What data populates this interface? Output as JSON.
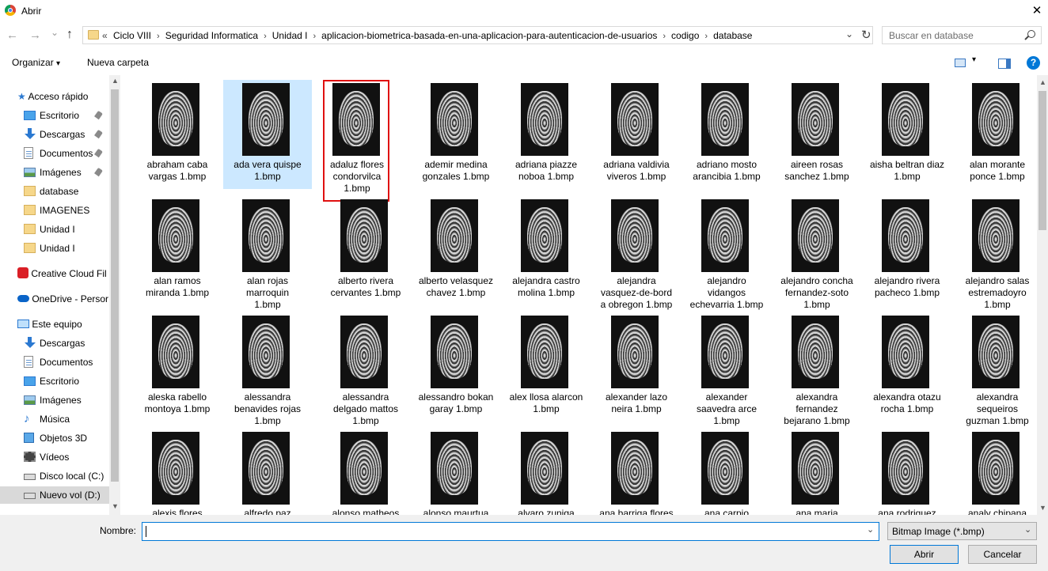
{
  "window": {
    "title": "Abrir",
    "close_glyph": "✕"
  },
  "nav_buttons": {
    "back": "←",
    "forward": "→",
    "recent": "⌄",
    "up": "↑"
  },
  "address": {
    "overflow": "«",
    "crumbs": [
      "Ciclo VIII",
      "Seguridad Informatica",
      "Unidad I",
      "aplicacion-biometrica-basada-en-una-aplicacion-para-autenticacion-de-usuarios",
      "codigo",
      "database"
    ],
    "separator": "›",
    "dropdown_glyph": "⌄",
    "refresh_glyph": "↻",
    "search_placeholder": "Buscar en database"
  },
  "toolbar": {
    "organize": "Organizar",
    "organize_arrow": "▾",
    "new_folder": "Nueva carpeta",
    "help": "?"
  },
  "sidebar": {
    "quick_access": "Acceso rápido",
    "quick_items": [
      {
        "label": "Escritorio",
        "icon": "desktop-icon",
        "pinned": true
      },
      {
        "label": "Descargas",
        "icon": "download-icon",
        "pinned": true
      },
      {
        "label": "Documentos",
        "icon": "documents-icon",
        "pinned": true
      },
      {
        "label": "Imágenes",
        "icon": "pictures-icon",
        "pinned": true
      },
      {
        "label": "database",
        "icon": "folder-icon",
        "pinned": false
      },
      {
        "label": "IMAGENES",
        "icon": "folder-icon",
        "pinned": false
      },
      {
        "label": "Unidad I",
        "icon": "folder-icon",
        "pinned": false
      },
      {
        "label": "Unidad I",
        "icon": "folder-icon",
        "pinned": false
      }
    ],
    "creative_cloud": "Creative Cloud Fil",
    "onedrive": "OneDrive - Persor",
    "this_pc": "Este equipo",
    "pc_items": [
      {
        "label": "Descargas",
        "icon": "download-icon"
      },
      {
        "label": "Documentos",
        "icon": "documents-icon"
      },
      {
        "label": "Escritorio",
        "icon": "desktop-icon"
      },
      {
        "label": "Imágenes",
        "icon": "pictures-icon"
      },
      {
        "label": "Música",
        "icon": "music-icon"
      },
      {
        "label": "Objetos 3D",
        "icon": "3d-objects-icon"
      },
      {
        "label": "Vídeos",
        "icon": "videos-icon"
      },
      {
        "label": "Disco local (C:)",
        "icon": "drive-icon"
      },
      {
        "label": "Nuevo vol (D:)",
        "icon": "drive-icon"
      }
    ],
    "pin_glyph": "📌"
  },
  "files": [
    [
      "abraham caba",
      "vargas 1.bmp"
    ],
    [
      "ada vera quispe",
      "1.bmp"
    ],
    [
      "adaluz flores",
      "condorvilca",
      "1.bmp"
    ],
    [
      "ademir medina",
      "gonzales 1.bmp"
    ],
    [
      "adriana piazze",
      "noboa 1.bmp"
    ],
    [
      "adriana valdivia",
      "viveros 1.bmp"
    ],
    [
      "adriano mosto",
      "arancibia 1.bmp"
    ],
    [
      "aireen rosas",
      "sanchez 1.bmp"
    ],
    [
      "aisha beltran diaz",
      "1.bmp"
    ],
    [
      "alan morante",
      "ponce 1.bmp"
    ],
    [
      "alan ramos",
      "miranda 1.bmp"
    ],
    [
      "alan rojas",
      "marroquin",
      "1.bmp"
    ],
    [
      "alberto rivera",
      "cervantes 1.bmp"
    ],
    [
      "alberto velasquez",
      "chavez 1.bmp"
    ],
    [
      "alejandra castro",
      "molina 1.bmp"
    ],
    [
      "alejandra",
      "vasquez-de-bord",
      "a obregon 1.bmp"
    ],
    [
      "alejandro",
      "vidangos",
      "echevarria 1.bmp"
    ],
    [
      "alejandro concha",
      "fernandez-soto",
      "1.bmp"
    ],
    [
      "alejandro rivera",
      "pacheco 1.bmp"
    ],
    [
      "alejandro salas",
      "estremadoyro",
      "1.bmp"
    ],
    [
      "aleska rabello",
      "montoya 1.bmp"
    ],
    [
      "alessandra",
      "benavides rojas",
      "1.bmp"
    ],
    [
      "alessandra",
      "delgado mattos",
      "1.bmp"
    ],
    [
      "alessandro bokan",
      "garay 1.bmp"
    ],
    [
      "alex llosa alarcon",
      "1.bmp"
    ],
    [
      "alexander lazo",
      "neira 1.bmp"
    ],
    [
      "alexander",
      "saavedra arce",
      "1.bmp"
    ],
    [
      "alexandra",
      "fernandez",
      "bejarano 1.bmp"
    ],
    [
      "alexandra otazu",
      "rocha 1.bmp"
    ],
    [
      "alexandra",
      "sequeiros",
      "guzman 1.bmp"
    ],
    [
      "alexis flores"
    ],
    [
      "alfredo paz"
    ],
    [
      "alonso matheos"
    ],
    [
      "alonso maurtua"
    ],
    [
      "alvaro zuniga"
    ],
    [
      "ana barriga flores"
    ],
    [
      "ana carpio"
    ],
    [
      "ana maria"
    ],
    [
      "ana rodriguez"
    ],
    [
      "analy chipana"
    ]
  ],
  "selected_index": 1,
  "highlighted_index": 2,
  "bottom": {
    "name_label": "Nombre:",
    "name_value": "",
    "filter": "Bitmap Image (*.bmp)",
    "open": "Abrir",
    "cancel": "Cancelar"
  },
  "colors": {
    "accent": "#0078d7",
    "selection": "#cce8ff",
    "highlight_box": "#e01010"
  }
}
